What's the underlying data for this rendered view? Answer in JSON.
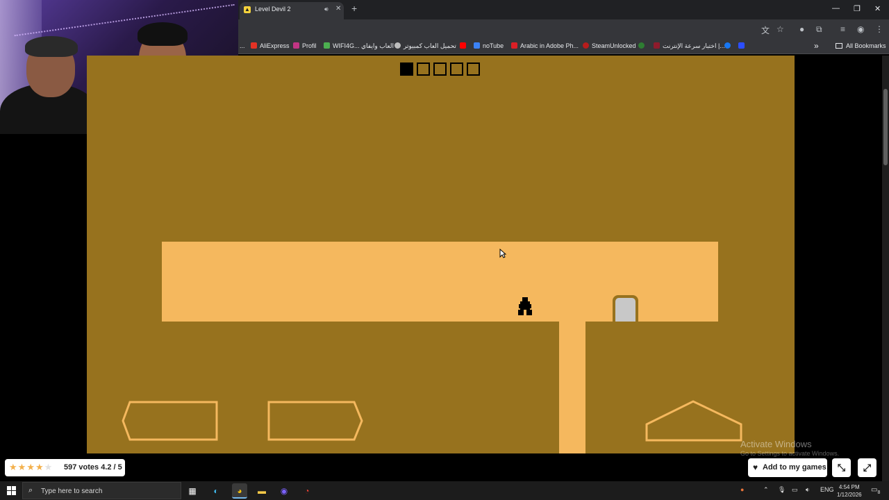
{
  "browser": {
    "tab_title": "Level Devil 2",
    "tab_favicon": "level-devil-favicon",
    "new_tab_icon": "+",
    "window_controls": [
      "—",
      "❐",
      "✕"
    ],
    "bookmarks": [
      {
        "label": "...",
        "color": "#35363a"
      },
      {
        "label": "AliExpress",
        "color": "#e43225"
      },
      {
        "label": "Profil",
        "color": "#c13584"
      },
      {
        "label": "WIFI4G... العاب وايفاي",
        "color": "#4caf50"
      },
      {
        "label": "تحميل العاب كمبيوتر",
        "color": "#bdbdbd"
      },
      {
        "label": "",
        "color": "#ff0000"
      },
      {
        "label": "noTube",
        "color": "#3b82f6"
      },
      {
        "label": "Arabic in Adobe Ph...",
        "color": "#da1f26"
      },
      {
        "label": "SteamUnlocked",
        "color": "#b71c1c"
      },
      {
        "label": "",
        "color": "#2e7d32"
      },
      {
        "label": "اختبار سرعة الإنترنت |...",
        "color": "#8e1b2c"
      },
      {
        "label": "",
        "color": "#1877f2"
      },
      {
        "label": "",
        "color": "#2b4eff"
      }
    ],
    "more_bookmarks": "»",
    "all_bookmarks": "All Bookmarks"
  },
  "game": {
    "stage_progress": {
      "completed": 1,
      "total": 5
    },
    "colors": {
      "background": "#97721e",
      "platform": "#f5b85e",
      "door": "#c8c8c8",
      "player": "#000000"
    }
  },
  "rating": {
    "stars_filled": 4.2,
    "stars_total": 5,
    "text": "597 votes 4.2 / 5"
  },
  "overlay": {
    "activate_title": "Activate Windows",
    "activate_sub": "Go to Settings to activate Windows."
  },
  "actions": {
    "add_label": "Add to my games",
    "shrink_icon": "⤡",
    "fullscreen_icon": "⤢"
  },
  "taskbar": {
    "search_placeholder": "Type here to search",
    "lang": "ENG",
    "time": "4:54 PM",
    "date": "1/12/2026",
    "notification_count": "8"
  }
}
